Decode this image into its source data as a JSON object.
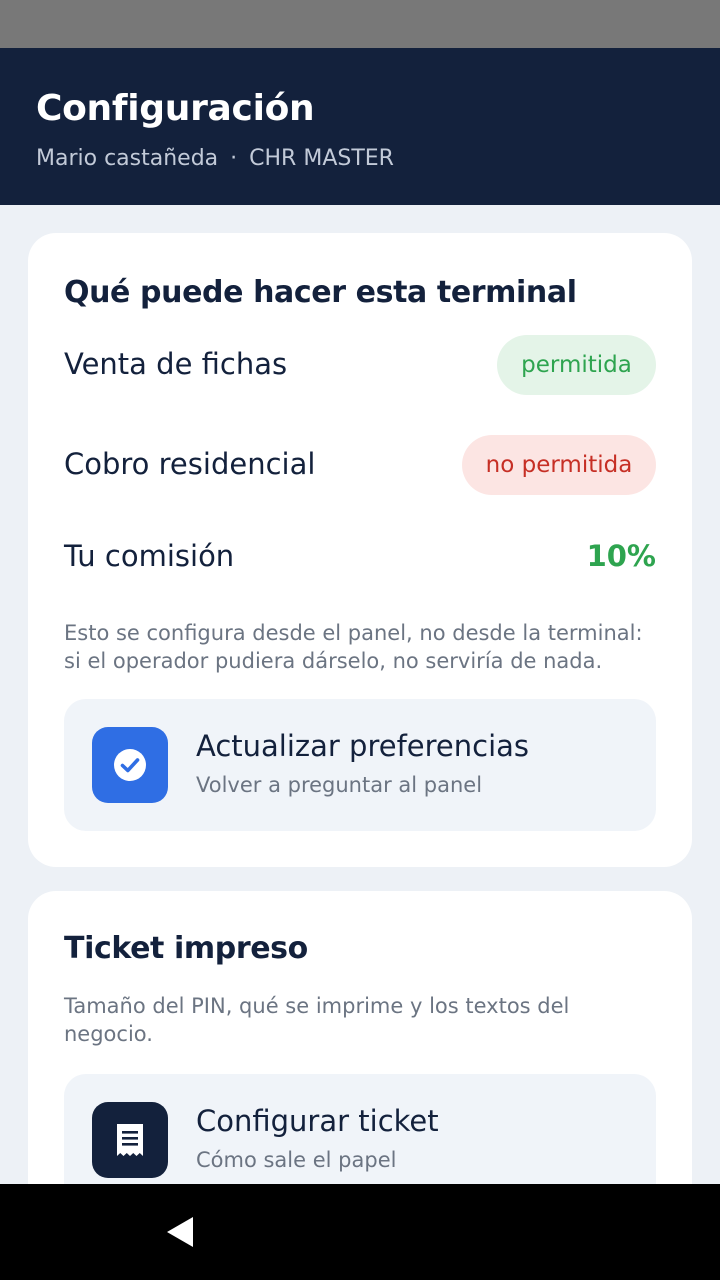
{
  "header": {
    "title": "Configuración",
    "user": "Mario castañeda",
    "separator": "·",
    "role": "CHR MASTER"
  },
  "capabilities": {
    "title": "Qué puede hacer esta terminal",
    "rows": [
      {
        "label": "Venta de fichas",
        "status": "permitida"
      },
      {
        "label": "Cobro residencial",
        "status": "no permitida"
      }
    ],
    "commission": {
      "label": "Tu comisión",
      "value": "10%"
    },
    "note": "Esto se configura desde el panel, no desde la terminal: si el operador pudiera dárselo, no serviría de nada.",
    "action": {
      "title": "Actualizar preferencias",
      "subtitle": "Volver a preguntar al panel",
      "icon": "check-circle-icon"
    }
  },
  "ticket": {
    "title": "Ticket impreso",
    "description": "Tamaño del PIN, qué se imprime y los textos del negocio.",
    "action": {
      "title": "Configurar ticket",
      "subtitle": "Cómo sale el papel",
      "icon": "receipt-icon"
    }
  },
  "colors": {
    "header_bg": "#13213c",
    "allowed": "#2ea44f",
    "denied": "#c62f25",
    "accent": "#2f6ee4"
  }
}
